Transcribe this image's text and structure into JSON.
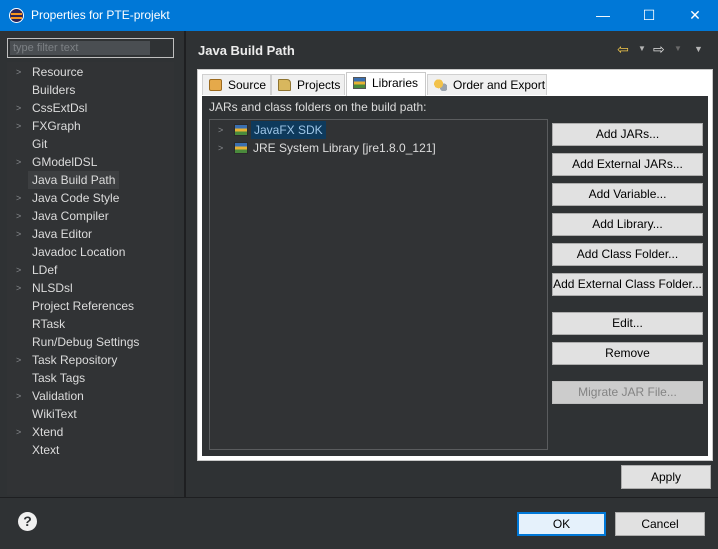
{
  "window": {
    "title": "Properties for PTE-projekt",
    "minimize_glyph": "—",
    "maximize_glyph": "☐",
    "close_glyph": "✕"
  },
  "sidebar": {
    "filter_placeholder": "type filter text",
    "items": [
      {
        "label": "Resource",
        "expandable": true
      },
      {
        "label": "Builders",
        "expandable": false
      },
      {
        "label": "CssExtDsl",
        "expandable": true
      },
      {
        "label": "FXGraph",
        "expandable": true
      },
      {
        "label": "Git",
        "expandable": false
      },
      {
        "label": "GModelDSL",
        "expandable": true
      },
      {
        "label": "Java Build Path",
        "expandable": false,
        "selected": true
      },
      {
        "label": "Java Code Style",
        "expandable": true
      },
      {
        "label": "Java Compiler",
        "expandable": true
      },
      {
        "label": "Java Editor",
        "expandable": true
      },
      {
        "label": "Javadoc Location",
        "expandable": false
      },
      {
        "label": "LDef",
        "expandable": true
      },
      {
        "label": "NLSDsl",
        "expandable": true
      },
      {
        "label": "Project References",
        "expandable": false
      },
      {
        "label": "RTask",
        "expandable": false
      },
      {
        "label": "Run/Debug Settings",
        "expandable": false
      },
      {
        "label": "Task Repository",
        "expandable": true
      },
      {
        "label": "Task Tags",
        "expandable": false
      },
      {
        "label": "Validation",
        "expandable": true
      },
      {
        "label": "WikiText",
        "expandable": false
      },
      {
        "label": "Xtend",
        "expandable": true
      },
      {
        "label": "Xtext",
        "expandable": false
      }
    ]
  },
  "page": {
    "title": "Java Build Path",
    "nav": {
      "back_glyph": "⇦",
      "forward_glyph": "⇨",
      "dropdown_glyph": "▼"
    }
  },
  "tabs": [
    {
      "label": "Source",
      "icon": "source-folder-icon"
    },
    {
      "label": "Projects",
      "icon": "project-folder-icon"
    },
    {
      "label": "Libraries",
      "icon": "library-icon",
      "active": true
    },
    {
      "label": "Order and Export",
      "icon": "order-export-icon"
    }
  ],
  "libraries": {
    "label": "JARs and class folders on the build path:",
    "entries": [
      {
        "label": "JavaFX SDK",
        "selected": true
      },
      {
        "label": "JRE System Library [jre1.8.0_121]",
        "selected": false
      }
    ],
    "buttons": {
      "add_jars": "Add JARs...",
      "add_external_jars": "Add External JARs...",
      "add_variable": "Add Variable...",
      "add_library": "Add Library...",
      "add_class_folder": "Add Class Folder...",
      "add_external_class_folder": "Add External Class Folder...",
      "edit": "Edit...",
      "remove": "Remove",
      "migrate_jar": "Migrate JAR File..."
    }
  },
  "apply": "Apply",
  "footer": {
    "help_glyph": "?",
    "ok": "OK",
    "cancel": "Cancel"
  },
  "colors": {
    "titlebar": "#0078d7",
    "dark_background": "#2f3234",
    "selection": "#0e3a5c"
  }
}
